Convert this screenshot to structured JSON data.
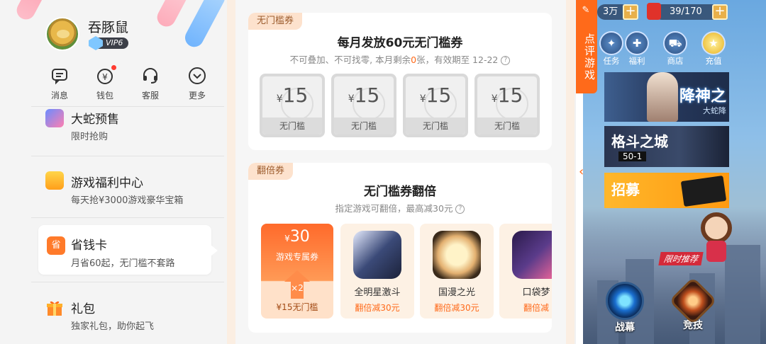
{
  "sidebar": {
    "username": "吞豚鼠",
    "vip_label": "VIP6",
    "quick_actions": [
      {
        "label": "消息",
        "icon": "message-icon"
      },
      {
        "label": "钱包",
        "icon": "wallet-icon"
      },
      {
        "label": "客服",
        "icon": "headset-icon"
      },
      {
        "label": "更多",
        "icon": "chevron-down-icon"
      }
    ],
    "items": [
      {
        "title": "大蛇预售",
        "subtitle": "限时抢购"
      },
      {
        "title": "游戏福利中心",
        "subtitle": "每天抢¥3000游戏豪华宝箱"
      },
      {
        "title": "省钱卡",
        "subtitle": "月省60起，无门槛不套路",
        "icon_text": "省"
      },
      {
        "title": "礼包",
        "subtitle": "独家礼包，助你起飞"
      }
    ]
  },
  "coupons_card": {
    "tag": "无门槛券",
    "title": "每月发放60元无门槛券",
    "subtitle_pre": "不可叠加、不可找零, 本月剩余",
    "subtitle_count": "0",
    "subtitle_post": "张，有效期至 12-22",
    "help": "?",
    "coupons": [
      {
        "symbol": "¥",
        "amount": "15",
        "label": "无门槛"
      },
      {
        "symbol": "¥",
        "amount": "15",
        "label": "无门槛"
      },
      {
        "symbol": "¥",
        "amount": "15",
        "label": "无门槛"
      },
      {
        "symbol": "¥",
        "amount": "15",
        "label": "无门槛"
      }
    ]
  },
  "double_card": {
    "tag": "翻倍券",
    "title": "无门槛券翻倍",
    "subtitle": "指定游戏可翻倍，最高减30元",
    "help": "?",
    "special": {
      "symbol": "¥",
      "amount": "30",
      "label": "游戏专属券",
      "multiplier": "×2",
      "base": "¥15无门槛"
    },
    "games": [
      {
        "name": "全明星激斗",
        "deal": "翻倍减30元",
        "color": "#3b4a78"
      },
      {
        "name": "国漫之光",
        "deal": "翻倍减30元",
        "color": "#e3b070"
      },
      {
        "name": "口袋梦",
        "deal": "翻倍减",
        "color": "#5a3b8a"
      }
    ]
  },
  "game_panel": {
    "review_tab": "点评游戏",
    "res1": "3万",
    "res2": "39/170",
    "nav": [
      "任务",
      "福利",
      "商店",
      "充值"
    ],
    "banners": [
      {
        "title": "降神之",
        "subtitle": "大蛇降"
      },
      {
        "title": "格斗之城",
        "subtitle": "50-1"
      },
      {
        "title": "招募"
      }
    ],
    "limited_label": "限时推荐",
    "buttons": [
      "战幕",
      "竞技"
    ]
  }
}
